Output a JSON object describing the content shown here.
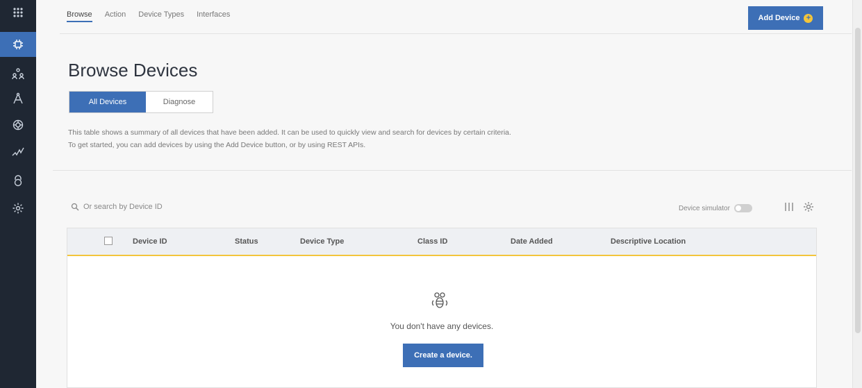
{
  "sidebar": {
    "items": [
      {
        "name": "apps-grid-icon",
        "active": false
      },
      {
        "name": "devices-icon",
        "active": true
      },
      {
        "name": "members-icon",
        "active": false
      },
      {
        "name": "rules-icon",
        "active": false
      },
      {
        "name": "extensions-icon",
        "active": false
      },
      {
        "name": "usage-icon",
        "active": false
      },
      {
        "name": "security-icon",
        "active": false
      },
      {
        "name": "settings-icon",
        "active": false
      }
    ]
  },
  "topnav": {
    "tabs": [
      "Browse",
      "Action",
      "Device Types",
      "Interfaces"
    ],
    "active": "Browse"
  },
  "header": {
    "add_button_label": "Add Device",
    "title": "Browse Devices"
  },
  "filters": {
    "all_label": "All Devices",
    "diagnose_label": "Diagnose"
  },
  "description": "This table shows a summary of all devices that have been added. It can be used to quickly view and search for devices by certain criteria. To get started, you can add devices by using the Add Device button, or by using REST APIs.",
  "search": {
    "placeholder": "Or search by Device ID"
  },
  "toolbar": {
    "simulator_label": "Device simulator",
    "simulator_on": false
  },
  "table": {
    "columns": [
      "Device ID",
      "Status",
      "Device Type",
      "Class ID",
      "Date Added",
      "Descriptive Location"
    ],
    "empty_text": "You don't have any devices.",
    "create_label": "Create a device."
  },
  "colors": {
    "accent": "#3d6fb6",
    "highlight": "#f3c53b",
    "sidebar": "#1f2733"
  }
}
